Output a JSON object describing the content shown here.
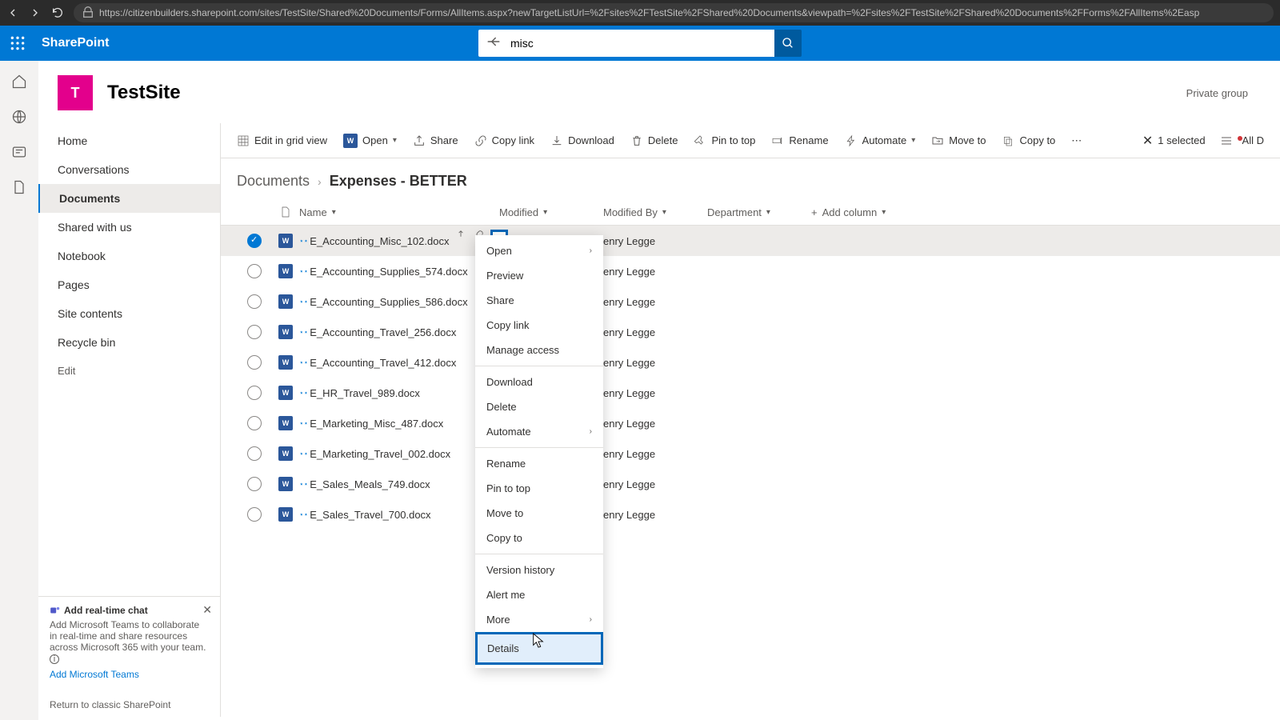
{
  "browser": {
    "url": "https://citizenbuilders.sharepoint.com/sites/TestSite/Shared%20Documents/Forms/AllItems.aspx?newTargetListUrl=%2Fsites%2FTestSite%2FShared%20Documents&viewpath=%2Fsites%2FTestSite%2FShared%20Documents%2FForms%2FAllItems%2Easp"
  },
  "suite": {
    "app_name": "SharePoint",
    "search_value": "misc"
  },
  "site": {
    "logo_letter": "T",
    "title": "TestSite",
    "privacy": "Private group"
  },
  "nav": {
    "items": [
      "Home",
      "Conversations",
      "Documents",
      "Shared with us",
      "Notebook",
      "Pages",
      "Site contents",
      "Recycle bin"
    ],
    "active_index": 2,
    "edit": "Edit"
  },
  "promo": {
    "title": "Add real-time chat",
    "body": "Add Microsoft Teams to collaborate in real-time and share resources across Microsoft 365 with your team.",
    "link": "Add Microsoft Teams"
  },
  "classic_link": "Return to classic SharePoint",
  "cmd": {
    "edit_grid": "Edit in grid view",
    "open": "Open",
    "share": "Share",
    "copy_link": "Copy link",
    "download": "Download",
    "delete": "Delete",
    "pin": "Pin to top",
    "rename": "Rename",
    "automate": "Automate",
    "move": "Move to",
    "copy": "Copy to",
    "selected": "1 selected",
    "all_docs": "All D"
  },
  "breadcrumb": {
    "root": "Documents",
    "current": "Expenses - BETTER"
  },
  "columns": {
    "name": "Name",
    "modified": "Modified",
    "modified_by": "Modified By",
    "department": "Department",
    "add": "Add column"
  },
  "files": [
    {
      "name": "E_Accounting_Misc_102.docx",
      "mod_by": "enry Legge",
      "selected": true
    },
    {
      "name": "E_Accounting_Supplies_574.docx",
      "mod_by": "enry Legge"
    },
    {
      "name": "E_Accounting_Supplies_586.docx",
      "mod_by": "enry Legge"
    },
    {
      "name": "E_Accounting_Travel_256.docx",
      "mod_by": "enry Legge"
    },
    {
      "name": "E_Accounting_Travel_412.docx",
      "mod_by": "enry Legge"
    },
    {
      "name": "E_HR_Travel_989.docx",
      "mod_by": "enry Legge"
    },
    {
      "name": "E_Marketing_Misc_487.docx",
      "mod_by": "enry Legge"
    },
    {
      "name": "E_Marketing_Travel_002.docx",
      "mod_by": "enry Legge"
    },
    {
      "name": "E_Sales_Meals_749.docx",
      "mod_by": "enry Legge"
    },
    {
      "name": "E_Sales_Travel_700.docx",
      "mod_by": "enry Legge"
    }
  ],
  "context_menu": {
    "items": [
      {
        "label": "Open",
        "submenu": true
      },
      {
        "label": "Preview"
      },
      {
        "label": "Share"
      },
      {
        "label": "Copy link"
      },
      {
        "label": "Manage access"
      },
      {
        "sep": true
      },
      {
        "label": "Download"
      },
      {
        "label": "Delete"
      },
      {
        "label": "Automate",
        "submenu": true
      },
      {
        "sep": true
      },
      {
        "label": "Rename"
      },
      {
        "label": "Pin to top"
      },
      {
        "label": "Move to"
      },
      {
        "label": "Copy to"
      },
      {
        "sep": true
      },
      {
        "label": "Version history"
      },
      {
        "label": "Alert me"
      },
      {
        "label": "More",
        "submenu": true
      },
      {
        "label": "Details",
        "highlighted": true
      }
    ]
  }
}
